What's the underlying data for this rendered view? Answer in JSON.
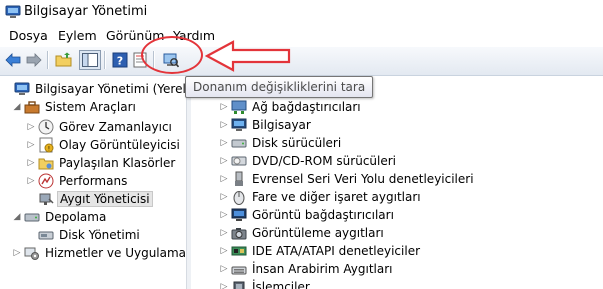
{
  "window": {
    "title": "Bilgisayar Yönetimi"
  },
  "menu": [
    "Dosya",
    "Eylem",
    "Görünüm",
    "Yardım"
  ],
  "toolbar": {
    "buttons": [
      "back-arrow-icon",
      "forward-arrow-icon",
      "up-folder-icon",
      "show-hide-tree-icon",
      "help-icon",
      "properties-icon",
      "scan-hardware-icon"
    ],
    "tooltip": "Donanım değişikliklerini tara"
  },
  "annotation": {
    "color": "#e3343a"
  },
  "tree": {
    "root": "Bilgisayar Yönetimi (Yerel)",
    "system_tools": "Sistem Araçları",
    "task_scheduler": "Görev Zamanlayıcı",
    "event_viewer": "Olay Görüntüleyicisi",
    "shared_folders": "Paylaşılan Klasörler",
    "performance": "Performans",
    "device_manager": "Aygıt Yöneticisi",
    "storage": "Depolama",
    "disk_management": "Disk Yönetimi",
    "services": "Hizmetler ve Uygulamalar"
  },
  "devices": [
    {
      "label": "Ağ bağdaştırıcıları",
      "icon": "network-adapter-icon"
    },
    {
      "label": "Bilgisayar",
      "icon": "computer-icon"
    },
    {
      "label": "Disk sürücüleri",
      "icon": "disk-drive-icon"
    },
    {
      "label": "DVD/CD-ROM sürücüleri",
      "icon": "dvd-drive-icon"
    },
    {
      "label": "Evrensel Seri Veri Yolu denetleyicileri",
      "icon": "usb-icon"
    },
    {
      "label": "Fare ve diğer işaret aygıtları",
      "icon": "mouse-icon"
    },
    {
      "label": "Görüntü bağdaştırıcıları",
      "icon": "display-adapter-icon"
    },
    {
      "label": "Görüntüleme aygıtları",
      "icon": "imaging-device-icon"
    },
    {
      "label": "IDE ATA/ATAPI denetleyiciler",
      "icon": "ide-controller-icon"
    },
    {
      "label": "İnsan Arabirim Aygıtları",
      "icon": "hid-icon"
    },
    {
      "label": "İşlemciler",
      "icon": "processor-icon"
    }
  ]
}
